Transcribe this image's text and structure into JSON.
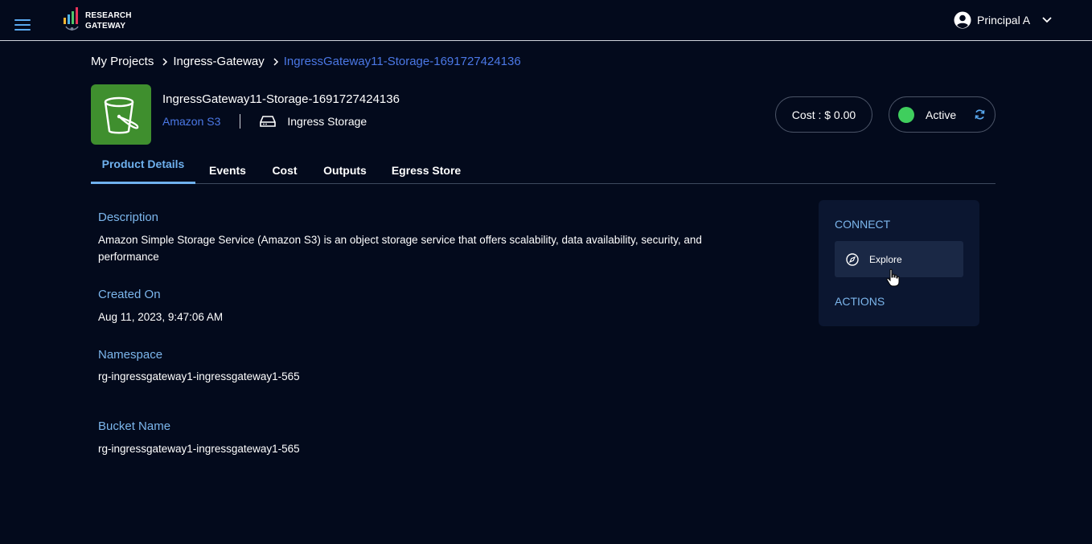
{
  "header": {
    "logo_line1": "RESEARCH",
    "logo_line2": "GATEWAY",
    "user_name": "Principal A",
    "icons": {
      "menu": "hamburger-menu-icon",
      "user": "user-circle-icon",
      "dropdown": "chevron-down-icon"
    }
  },
  "breadcrumb": {
    "items": [
      "My Projects",
      "Ingress-Gateway",
      "IngressGateway11-Storage-1691727424136"
    ]
  },
  "product": {
    "title": "IngressGateway11-Storage-1691727424136",
    "type": "Amazon S3",
    "storage_label": "Ingress Storage",
    "cost": "Cost : $ 0.00",
    "status": "Active",
    "status_color": "#3fce5d",
    "icons": {
      "product": "s3-bucket-icon",
      "storage": "hard-drive-icon",
      "refresh": "refresh-icon"
    }
  },
  "tabs": [
    "Product Details",
    "Events",
    "Cost",
    "Outputs",
    "Egress Store"
  ],
  "active_tab": "Product Details",
  "details": {
    "description_label": "Description",
    "description_value": "Amazon Simple Storage Service (Amazon S3) is an object storage service that offers scalability, data availability, security, and performance",
    "created_label": "Created On",
    "created_value": "Aug 11, 2023, 9:47:06 AM",
    "namespace_label": "Namespace",
    "namespace_value": "rg-ingressgateway1-ingressgateway1-565",
    "bucket_label": "Bucket Name",
    "bucket_value": "rg-ingressgateway1-ingressgateway1-565"
  },
  "side_panel": {
    "connect_heading": "CONNECT",
    "explore_label": "Explore",
    "actions_heading": "ACTIONS",
    "icons": {
      "explore": "compass-icon"
    }
  },
  "colors": {
    "background": "#030a1c",
    "accent_blue": "#4b78e6",
    "label_blue": "#7cb6ec",
    "tab_active": "#6fb1ee",
    "card_bg": "#0b1630",
    "s3_green": "#3f8f2e"
  }
}
